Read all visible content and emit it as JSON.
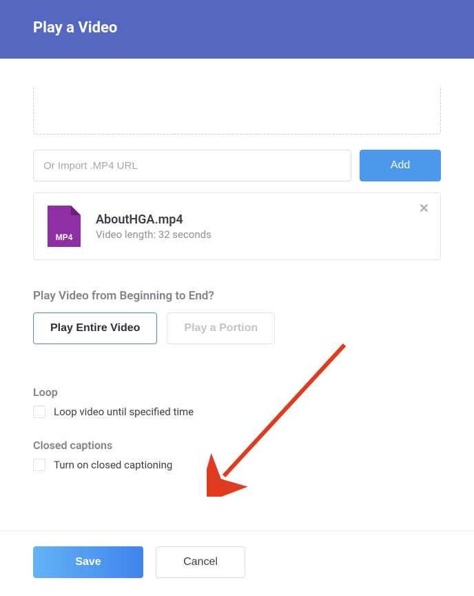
{
  "header": {
    "title": "Play a Video"
  },
  "import": {
    "placeholder": "Or Import .MP4 URL",
    "add_label": "Add"
  },
  "file": {
    "name": "AboutHGA.mp4",
    "meta": "Video length: 32 seconds",
    "badge": "MP4"
  },
  "range_section": {
    "label": "Play Video from Beginning to End?",
    "option_entire": "Play Entire Video",
    "option_portion": "Play a Portion"
  },
  "loop_section": {
    "label": "Loop",
    "checkbox_label": "Loop video until specified time"
  },
  "cc_section": {
    "label": "Closed captions",
    "checkbox_label": "Turn on closed captioning"
  },
  "footer": {
    "save": "Save",
    "cancel": "Cancel"
  }
}
